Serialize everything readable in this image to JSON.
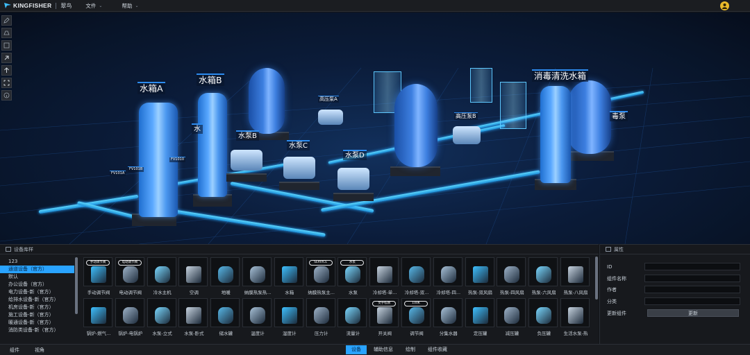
{
  "header": {
    "brand": "KINGFISHER",
    "subbrand": "翠鸟",
    "menu": [
      {
        "label": "文件"
      },
      {
        "label": "帮助"
      }
    ]
  },
  "scene": {
    "labels": {
      "tank_a": "水箱A",
      "tank_b": "水箱B",
      "pump_b": "水泵B",
      "pump_c": "水泵C",
      "pump_d": "水泵D",
      "hp_pump_a": "高压泵A",
      "hp_pump_b": "高压泵B",
      "disinfect_tank": "消毒清洗水箱",
      "fv101a": "FV101A",
      "fv101b": "FV101B",
      "fv101c": "FV1010",
      "water_cut": "水",
      "pump_cut": "毒泵"
    }
  },
  "library": {
    "title": "设备库样",
    "categories": [
      "123",
      "通道设备（官方）",
      "默认",
      "办公设备（官方）",
      "电力设备-新（官方）",
      "给排水设备-新（官方）",
      "机房设备-新（官方）",
      "施工设备-新（官方）",
      "暖通设备-新（官方）",
      "消防类设备-新（官方）"
    ],
    "active_index": 1,
    "items_row1": [
      {
        "label": "手动调节阀",
        "tag": "手动调节阀"
      },
      {
        "label": "电动调节阀",
        "tag": "电动调节阀"
      },
      {
        "label": "冷水主机",
        "tag": ""
      },
      {
        "label": "空调",
        "tag": ""
      },
      {
        "label": "地暖",
        "tag": ""
      },
      {
        "label": "纳膜热泵热...",
        "tag": ""
      },
      {
        "label": "水箱",
        "tag": ""
      },
      {
        "label": "纳膜热泵主...",
        "tag": "SERVICE"
      },
      {
        "label": "水泵",
        "tag": "水泵"
      },
      {
        "label": "冷却塔-单...",
        "tag": ""
      },
      {
        "label": "冷却塔-双...",
        "tag": ""
      },
      {
        "label": "冷却塔-四...",
        "tag": ""
      },
      {
        "label": "热泵-双风扇",
        "tag": ""
      },
      {
        "label": "热泵-四风扇",
        "tag": ""
      },
      {
        "label": "热泵-六风扇",
        "tag": ""
      },
      {
        "label": "热泵-八风扇",
        "tag": ""
      }
    ],
    "items_row2": [
      {
        "label": "锅炉-燃气...",
        "tag": ""
      },
      {
        "label": "锅炉-电锅炉",
        "tag": ""
      },
      {
        "label": "水泵-立式",
        "tag": ""
      },
      {
        "label": "水泵-卧式",
        "tag": ""
      },
      {
        "label": "储水罐",
        "tag": ""
      },
      {
        "label": "温度计",
        "tag": ""
      },
      {
        "label": "湿度计",
        "tag": ""
      },
      {
        "label": "压力计",
        "tag": ""
      },
      {
        "label": "流量计",
        "tag": ""
      },
      {
        "label": "开关阀",
        "tag": "文字标牌"
      },
      {
        "label": "调节阀",
        "tag": "100K"
      },
      {
        "label": "分集水器",
        "tag": ""
      },
      {
        "label": "定压罐",
        "tag": ""
      },
      {
        "label": "减压罐",
        "tag": ""
      },
      {
        "label": "负压罐",
        "tag": ""
      },
      {
        "label": "生活水泵-热",
        "tag": ""
      }
    ]
  },
  "properties": {
    "title": "属性",
    "fields": [
      {
        "label": "ID",
        "value": ""
      },
      {
        "label": "组件名称",
        "value": ""
      },
      {
        "label": "作者",
        "value": ""
      },
      {
        "label": "分类",
        "value": ""
      }
    ],
    "update_label": "更新组件",
    "update_button": "更新"
  },
  "footer": {
    "left": [
      "组件",
      "视角"
    ],
    "tabs": [
      "设备",
      "辅助信息",
      "绘制",
      "组件收藏"
    ],
    "active_tab": 0
  },
  "colors": {
    "accent": "#29a3ff",
    "avatar": "#e9b92a",
    "pipe": "#3ec0ff"
  }
}
